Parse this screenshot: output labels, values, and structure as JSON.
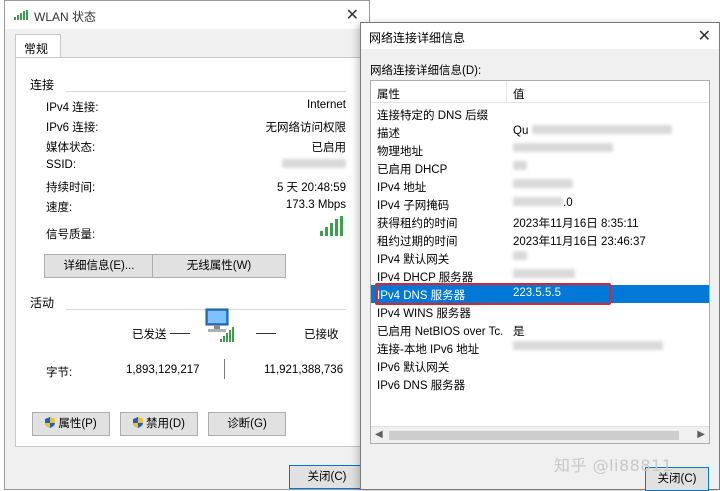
{
  "left_window": {
    "title": "WLAN 状态",
    "tab": "常规",
    "connection": {
      "heading": "连接",
      "rows": [
        {
          "label": "IPv4 连接:",
          "value": "Internet"
        },
        {
          "label": "IPv6 连接:",
          "value": "无网络访问权限"
        },
        {
          "label": "媒体状态:",
          "value": "已启用"
        },
        {
          "label": "SSID:",
          "value": ""
        },
        {
          "label": "持续时间:",
          "value": "5 天 20:48:59"
        },
        {
          "label": "速度:",
          "value": "173.3 Mbps"
        },
        {
          "label": "信号质量:",
          "value": ""
        }
      ]
    },
    "details_button": "详细信息(E)...",
    "wireless_button": "无线属性(W)",
    "activity": {
      "heading": "活动",
      "sent_label": "已发送",
      "received_label": "已接收",
      "bytes_label": "字节:",
      "bytes_sent": "1,893,129,217",
      "bytes_received": "11,921,388,736"
    },
    "properties_button": "属性(P)",
    "disable_button": "禁用(D)",
    "diagnose_button": "诊断(G)",
    "close_button": "关闭(C)"
  },
  "right_window": {
    "title": "网络连接详细信息",
    "list_label": "网络连接详细信息(D):",
    "column_property": "属性",
    "column_value": "值",
    "rows": [
      {
        "key": "连接特定的 DNS 后缀",
        "value": ""
      },
      {
        "key": "描述",
        "value": "Qu"
      },
      {
        "key": "物理地址",
        "value": ""
      },
      {
        "key": "已启用 DHCP",
        "value": ""
      },
      {
        "key": "IPv4 地址",
        "value": ""
      },
      {
        "key": "IPv4 子网掩码",
        "value": ".0"
      },
      {
        "key": "获得租约的时间",
        "value": "2023年11月16日 8:35:11"
      },
      {
        "key": "租约过期的时间",
        "value": "2023年11月16日 23:46:37"
      },
      {
        "key": "IPv4 默认网关",
        "value": ""
      },
      {
        "key": "IPv4 DHCP 服务器",
        "value": ""
      },
      {
        "key": "IPv4 DNS 服务器",
        "value": "223.5.5.5"
      },
      {
        "key": "IPv4 WINS 服务器",
        "value": ""
      },
      {
        "key": "已启用 NetBIOS over Tc...",
        "value": "是"
      },
      {
        "key": "连接-本地 IPv6 地址",
        "value": ""
      },
      {
        "key": "IPv6 默认网关",
        "value": ""
      },
      {
        "key": "IPv6 DNS 服务器",
        "value": ""
      }
    ],
    "close_button": "关闭(C)"
  },
  "watermark": "知乎 @li88811",
  "colors": {
    "selection": "#0078d7",
    "highlight_box": "#d9252b",
    "signal": "#3aa14a"
  }
}
